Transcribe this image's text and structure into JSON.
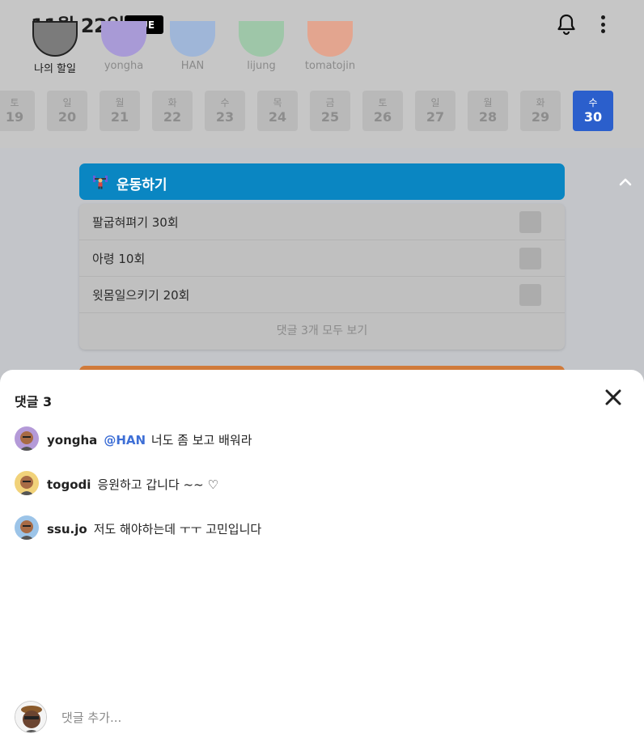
{
  "header": {
    "date": "11월 22일",
    "day_badge": "TUE",
    "bell_icon": "bell-icon",
    "more_icon": "more-vertical-icon"
  },
  "friends": [
    {
      "name": "나의 할일",
      "color": "#7b7b7b",
      "self": true
    },
    {
      "name": "yongha",
      "color": "#a89ad6"
    },
    {
      "name": "HAN",
      "color": "#9fb6d8"
    },
    {
      "name": "lijung",
      "color": "#9ec6a8"
    },
    {
      "name": "tomatojin",
      "color": "#e3a58f"
    }
  ],
  "calendar": [
    {
      "dow": "토",
      "day": "19"
    },
    {
      "dow": "일",
      "day": "20"
    },
    {
      "dow": "월",
      "day": "21"
    },
    {
      "dow": "화",
      "day": "22"
    },
    {
      "dow": "수",
      "day": "23"
    },
    {
      "dow": "목",
      "day": "24"
    },
    {
      "dow": "금",
      "day": "25"
    },
    {
      "dow": "토",
      "day": "26"
    },
    {
      "dow": "일",
      "day": "27"
    },
    {
      "dow": "월",
      "day": "28"
    },
    {
      "dow": "화",
      "day": "29"
    },
    {
      "dow": "수",
      "day": "30",
      "active": true
    }
  ],
  "category": {
    "title": "운동하기",
    "icon": "weightlifter-icon",
    "color": "#0a86c2",
    "tasks": [
      {
        "label": "팔굽혀펴기 30회"
      },
      {
        "label": "아령 10회"
      },
      {
        "label": "윗몸일으키기 20회"
      }
    ],
    "see_all": "댓글 3개 모두 보기"
  },
  "comments_sheet": {
    "title": "댓글 3",
    "close_icon": "close-icon",
    "comments": [
      {
        "user": "yongha",
        "mention": "@HAN",
        "text": "너도 좀 보고 배워라",
        "avatar_color": "#b49ad8"
      },
      {
        "user": "togodi",
        "mention": "",
        "text": "응원하고 갑니다 ~~ ♡",
        "avatar_color": "#f1d27a"
      },
      {
        "user": "ssu.jo",
        "mention": "",
        "text": "저도 해야하는데 ㅜㅜ 고민입니다",
        "avatar_color": "#9cc4e8"
      }
    ],
    "add_placeholder": "댓글 추가..."
  }
}
